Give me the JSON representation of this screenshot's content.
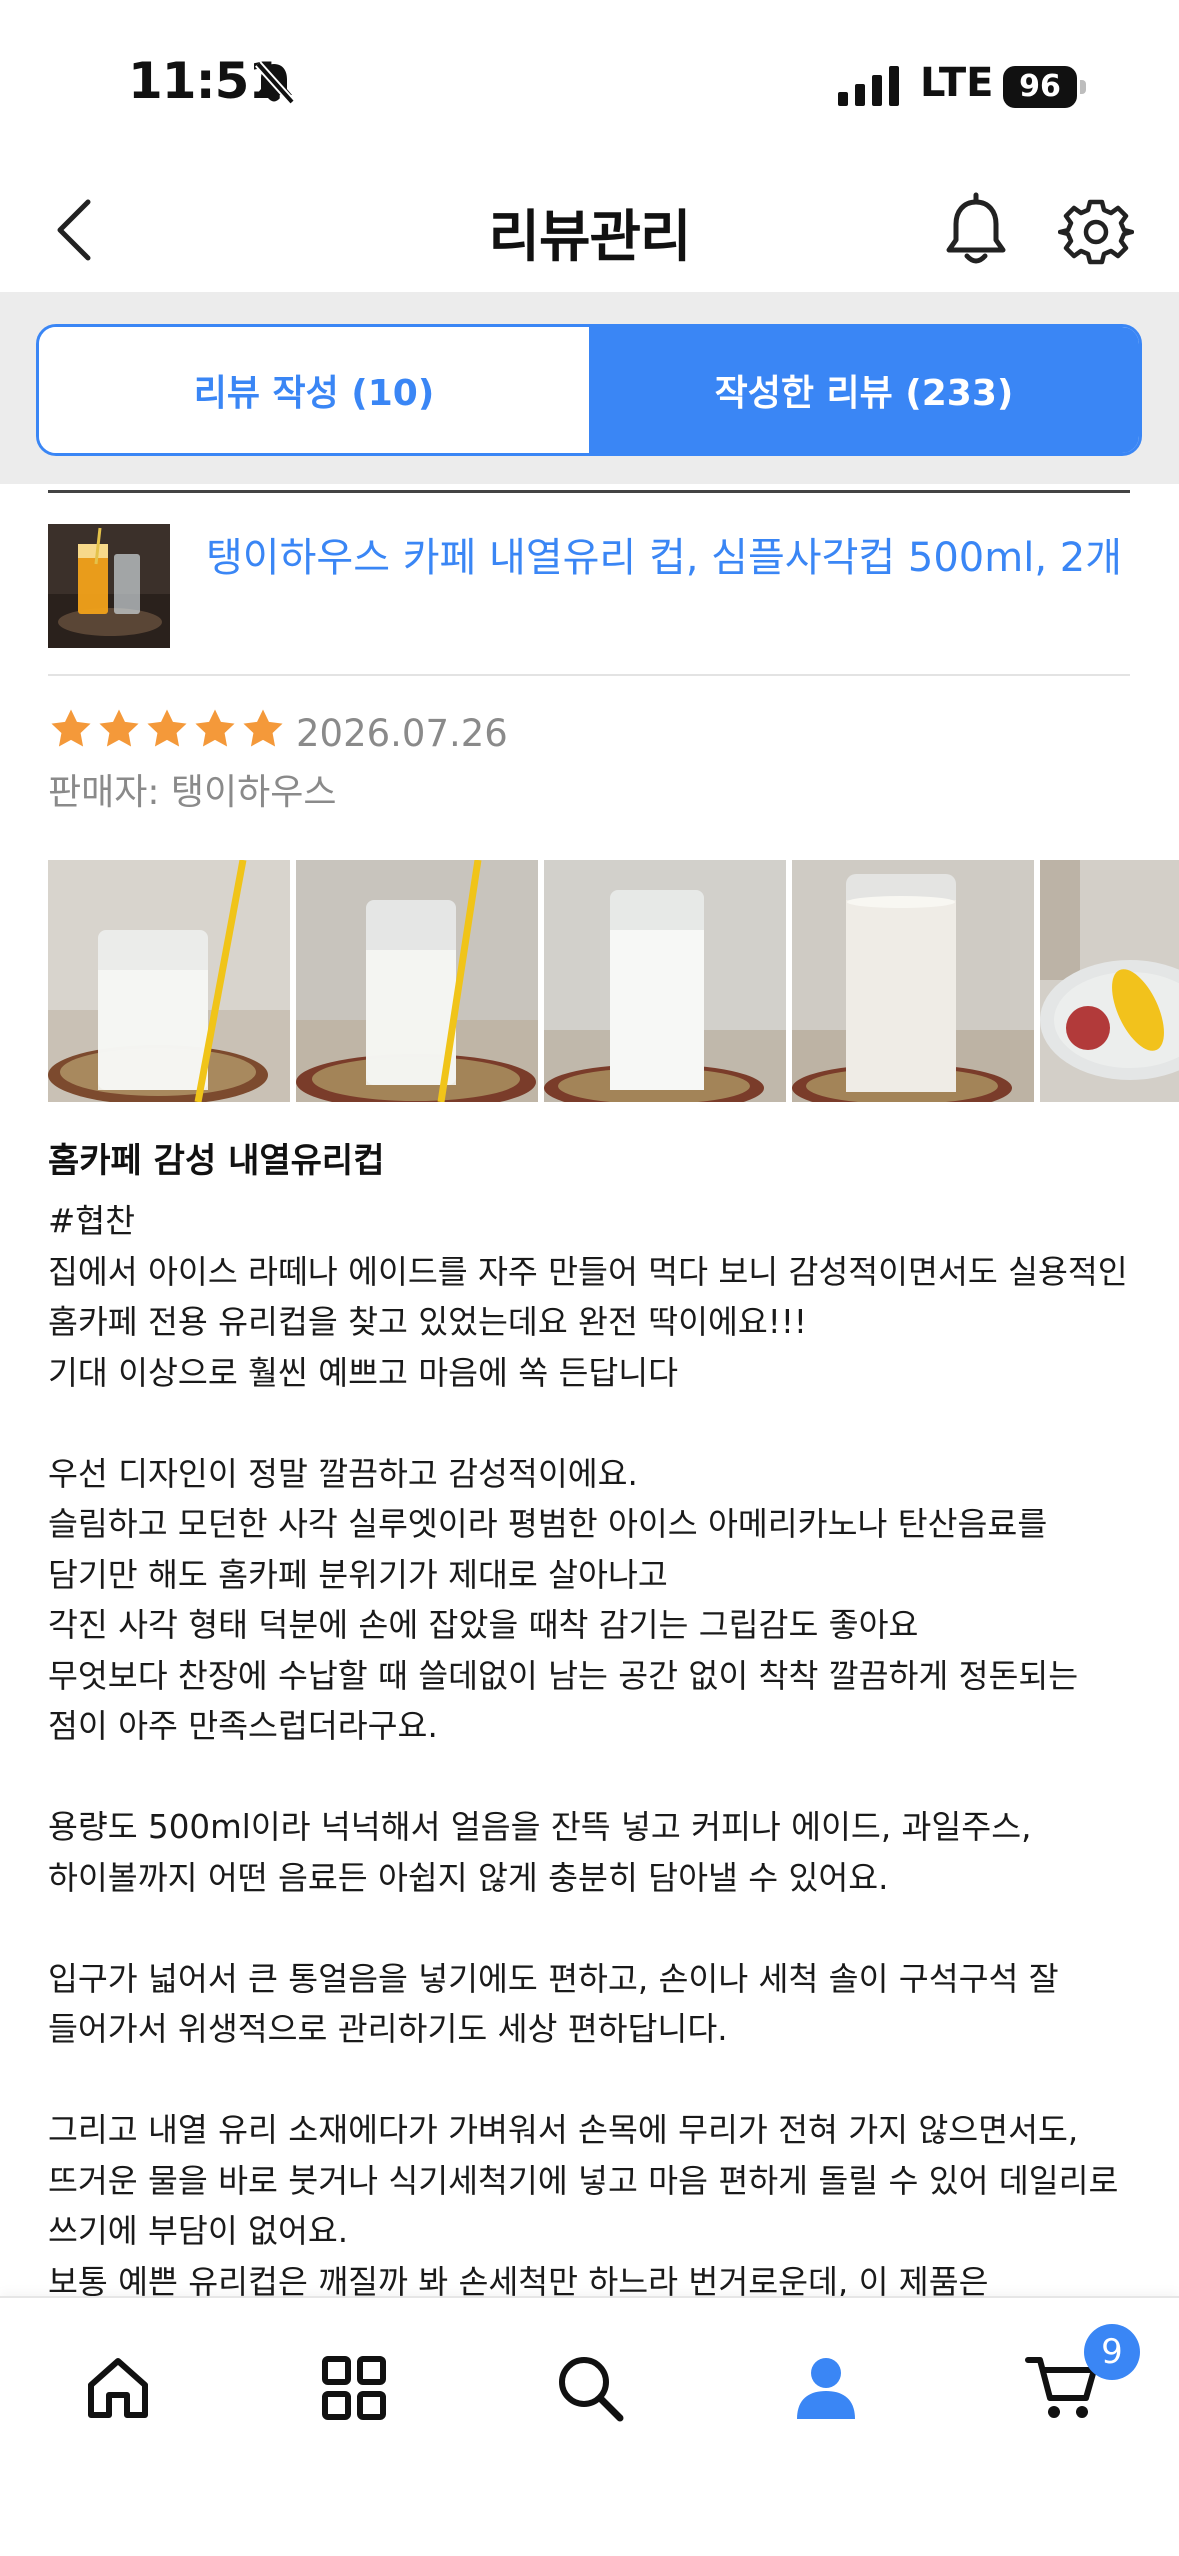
{
  "status": {
    "time": "11:51",
    "network": "LTE",
    "battery": "96"
  },
  "header": {
    "title": "리뷰관리"
  },
  "tabs": [
    {
      "label": "리뷰 작성 (10)",
      "active": false
    },
    {
      "label": "작성한 리뷰 (233)",
      "active": true
    }
  ],
  "product": {
    "name": "탱이하우스 카페 내열유리 컵, 심플사각컵 500ml, 2개"
  },
  "review": {
    "rating": 5,
    "date": "2026.07.26",
    "seller": "판매자: 탱이하우스",
    "title": "홈카페 감성 내열유리컵",
    "body_lines": [
      "#협찬",
      "집에서 아이스 라떼나 에이드를 자주 만들어 먹다 보니 감성적이면서도 실용적인 홈카페 전용 유리컵을 찾고 있었는데요 완전 딱이에요!!!",
      "기대 이상으로 훨씬 예쁘고 마음에 쏙 든답니다",
      "",
      "우선 디자인이 정말 깔끔하고 감성적이에요.",
      "슬림하고 모던한 사각 실루엣이라 평범한 아이스 아메리카노나 탄산음료를 담기만 해도 홈카페 분위기가 제대로 살아나고",
      "각진 사각 형태 덕분에 손에 잡았을 때착 감기는 그립감도 좋아요",
      "무엇보다 찬장에 수납할 때 쓸데없이 남는 공간 없이 착착 깔끔하게 정돈되는 점이 아주 만족스럽더라구요.",
      "",
      "용량도 500ml이라 넉넉해서 얼음을 잔뜩 넣고 커피나 에이드, 과일주스, 하이볼까지 어떤 음료든 아쉽지 않게 충분히 담아낼 수 있어요.",
      "",
      "입구가 넓어서 큰 통얼음을 넣기에도 편하고, 손이나 세척 솔이 구석구석 잘 들어가서 위생적으로 관리하기도 세상 편하답니다.",
      "",
      "그리고 내열 유리 소재에다가 가벼워서 손목에 무리가 전혀 가지 않으면서도, 뜨거운 물을 바로 붓거나 식기세척기에 넣고 마음 편하게 돌릴 수 있어 데일리로 쓰기에 부담이 없어요.",
      "보통 예쁜 유리컵은 깨질까 봐 손세척만 하느라 번거로운데, 이 제품은 식기세척기"
    ]
  },
  "bottom_nav": {
    "cart_count": "9"
  },
  "colors": {
    "accent": "#3a86f5",
    "star": "#f4993a",
    "muted_text": "#8a8a8a"
  },
  "icons": [
    "back-chevron-icon",
    "bell-icon",
    "gear-icon",
    "home-icon",
    "category-grid-icon",
    "search-icon",
    "user-icon",
    "cart-icon"
  ]
}
